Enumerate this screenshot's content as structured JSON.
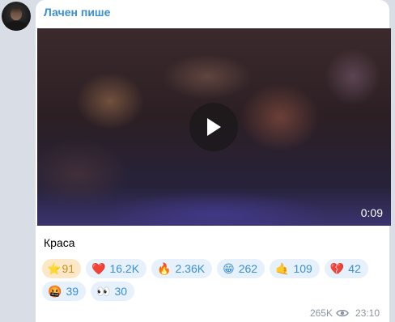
{
  "post": {
    "sender": "Лачен пише",
    "video_duration": "0:09",
    "caption": "Краса",
    "views": "265K",
    "time": "23:10"
  },
  "reactions": [
    {
      "emoji": "⭐",
      "count": "91",
      "selected": true
    },
    {
      "emoji": "❤️",
      "count": "16.2K"
    },
    {
      "emoji": "🔥",
      "count": "2.36K"
    },
    {
      "emoji": "😁",
      "count": "262"
    },
    {
      "emoji": "🤙",
      "count": "109"
    },
    {
      "emoji": "💔",
      "count": "42"
    },
    {
      "emoji": "🤬",
      "count": "39"
    },
    {
      "emoji": "👀",
      "count": "30"
    }
  ],
  "icons": {
    "avatar": "channel-avatar",
    "play": "play-icon",
    "views": "eye-icon"
  }
}
